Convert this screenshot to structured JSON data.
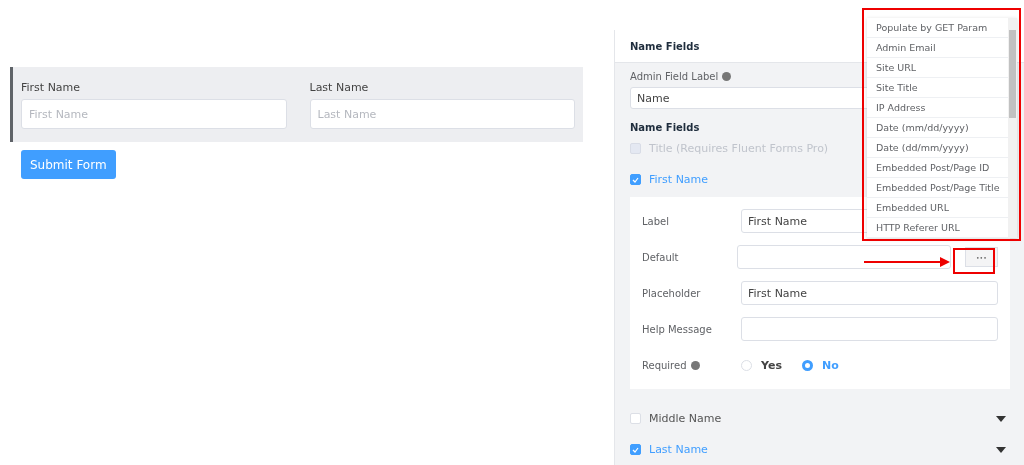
{
  "form": {
    "fields": [
      {
        "label": "First Name",
        "placeholder": "First Name"
      },
      {
        "label": "Last Name",
        "placeholder": "Last Name"
      }
    ],
    "submit": "Submit Form"
  },
  "panel": {
    "title": "Name Fields",
    "admin_label": "Admin Field Label",
    "admin_value": "Name",
    "section_title": "Name Fields",
    "name_fields": [
      {
        "label": "Title (Requires Fluent Forms Pro)",
        "checked": false,
        "disabled": true,
        "expanded": false
      },
      {
        "label": "First Name",
        "checked": true,
        "disabled": false,
        "expanded": true
      },
      {
        "label": "Middle Name",
        "checked": false,
        "disabled": false,
        "expanded": false
      },
      {
        "label": "Last Name",
        "checked": true,
        "disabled": false,
        "expanded": false
      }
    ],
    "settings": {
      "label_text": "Label",
      "label_value": "First Name",
      "default_text": "Default",
      "more": "•••",
      "placeholder_text": "Placeholder",
      "placeholder_field": {
        "value": "First Name"
      },
      "help_text": "Help Message",
      "required_text": "Required",
      "options": [
        {
          "label": "Yes",
          "selected": false
        },
        {
          "label": "No",
          "selected": true
        }
      ]
    }
  },
  "dropdown": {
    "items": [
      "Populate by GET Param",
      "Admin Email",
      "Site URL",
      "Site Title",
      "IP Address",
      "Date (mm/dd/yyyy)",
      "Date (dd/mm/yyyy)",
      "Embedded Post/Page ID",
      "Embedded Post/Page Title",
      "Embedded URL",
      "HTTP Referer URL"
    ]
  }
}
